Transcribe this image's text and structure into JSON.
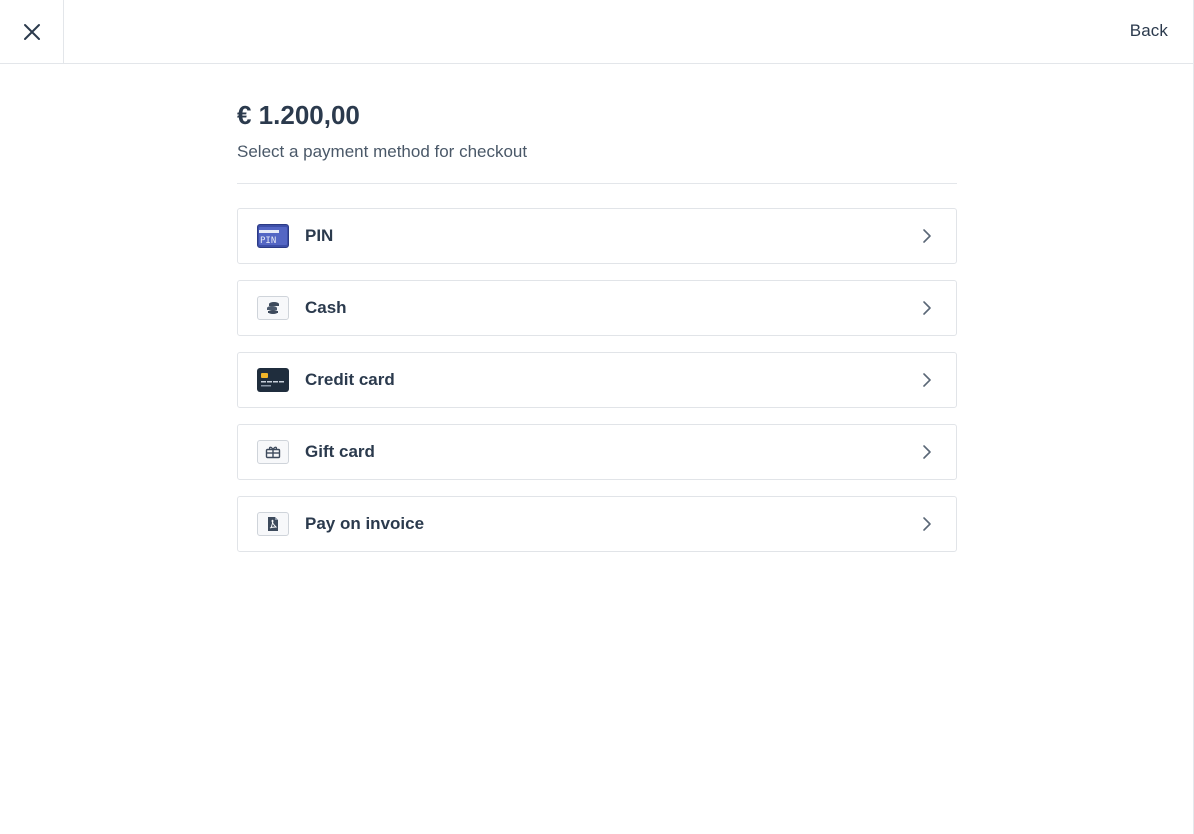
{
  "header": {
    "back_label": "Back"
  },
  "checkout": {
    "amount": "€ 1.200,00",
    "subtitle": "Select a payment method for checkout"
  },
  "payment_methods": [
    {
      "label": "PIN",
      "icon": "pin-card-icon"
    },
    {
      "label": "Cash",
      "icon": "cash-coins-icon"
    },
    {
      "label": "Credit card",
      "icon": "credit-card-icon"
    },
    {
      "label": "Gift card",
      "icon": "gift-card-icon"
    },
    {
      "label": "Pay on invoice",
      "icon": "invoice-document-icon"
    }
  ],
  "pin_icon_text": "PIN",
  "colors": {
    "text": "#2b3a4d",
    "border": "#e1e4e8",
    "pin_blue": "#3d4fa8",
    "credit_card_dark": "#1f2d3d",
    "chip_gold": "#f0b429"
  }
}
